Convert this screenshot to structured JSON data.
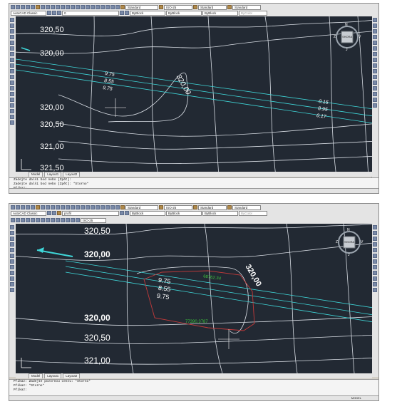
{
  "shot1": {
    "toolbar": {
      "workspace": "AutoCAD Classic",
      "text_style": "Standard",
      "dim_style": "ISO-25",
      "table_style": "Standard",
      "mleader_style": "Standard",
      "layer": "0",
      "color": "ByBlock",
      "linetype": "ByBlock",
      "lineweight": "ByBlock",
      "plotstyle": "ByColor"
    },
    "contours": {
      "top1": "320,50",
      "top2": "320,00",
      "mid": "320,00",
      "low1": "320,00",
      "low2": "320,50",
      "low3": "321,00",
      "low4": "321,50"
    },
    "left_values": [
      "9.75",
      "8.55",
      "9.75"
    ],
    "right_values": [
      "0.15",
      "8.95",
      "0.17"
    ],
    "viewcube": {
      "top": "N",
      "left": "Z",
      "right": "V",
      "bottom": "J",
      "face": "SHORA"
    },
    "tabs": [
      "Model",
      "Layout1",
      "Layout2"
    ],
    "command_lines": [
      "Zadejte další bod nebo [Zpět]:",
      "Zadejte další bod nebo [Zpět]: *Storno*",
      "Příkaz:"
    ]
  },
  "shot2": {
    "toolbar": {
      "workspace": "AutoCAD Classic",
      "text_style": "Standard",
      "dim_style": "ISO-25",
      "table_style": "Standard",
      "mleader_style": "Standard",
      "layer": "profil",
      "color": "ByBlock",
      "linetype": "ByBlock",
      "lineweight": "ByBlock",
      "plotstyle": "ByColor",
      "anno_scale": "ISO-25"
    },
    "contours": {
      "top1": "320,50",
      "top2": "320,00",
      "mid": "320,00",
      "low1": "320,00",
      "low2": "320,50",
      "low3": "321,00"
    },
    "left_values": [
      "9.75",
      "8.55",
      "9.75"
    ],
    "area_labels": [
      "68762.34",
      "77390.3787"
    ],
    "viewcube": {
      "top": "N",
      "left": "Z",
      "right": "V",
      "bottom": "J",
      "face": "SHORA"
    },
    "tabs": [
      "Model",
      "Layout1",
      "Layout2"
    ],
    "command_lines": [
      "Příkaz: Zadejte pozornou cestu: *Storno*",
      "Příkaz: *Storno*",
      "Příkaz:"
    ],
    "status_model": "MODEL"
  }
}
